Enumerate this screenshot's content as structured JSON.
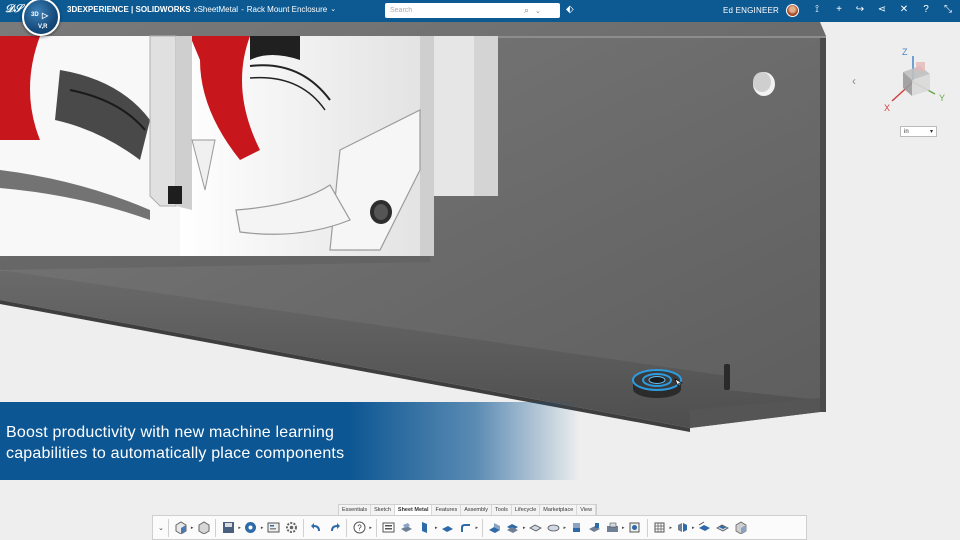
{
  "topbar": {
    "compass_labels": [
      "3D",
      "V,R"
    ],
    "brand": "3DEXPERIENCE | SOLIDWORKS",
    "app": "xSheetMetal",
    "separator": "-",
    "document": "Rack Mount Enclosure",
    "search_placeholder": "Search",
    "user_name": "Ed ENGINEER",
    "icons": [
      "bookmark-icon",
      "compass-icon",
      "add-icon",
      "share-icon",
      "network-icon",
      "tools-icon",
      "help-icon",
      "collapse-icon"
    ]
  },
  "viewport": {
    "triad": {
      "x": "X",
      "y": "Y",
      "z": "Z"
    },
    "units": "in"
  },
  "banner": {
    "line1": "Boost productivity with new machine learning",
    "line2": "capabilities to automatically place components"
  },
  "action_bar": {
    "tabs": [
      "Essentials",
      "Sketch",
      "Sheet Metal",
      "Features",
      "Assembly",
      "Tools",
      "Lifecycle",
      "Marketplace",
      "View"
    ],
    "active_tab": "Sheet Metal"
  },
  "colors": {
    "topbar": "#0d5a93",
    "banner": "#0c5693",
    "fan_blade": "#c8161d",
    "plate": "#6d6d6d",
    "highlight": "#2d9be0"
  }
}
